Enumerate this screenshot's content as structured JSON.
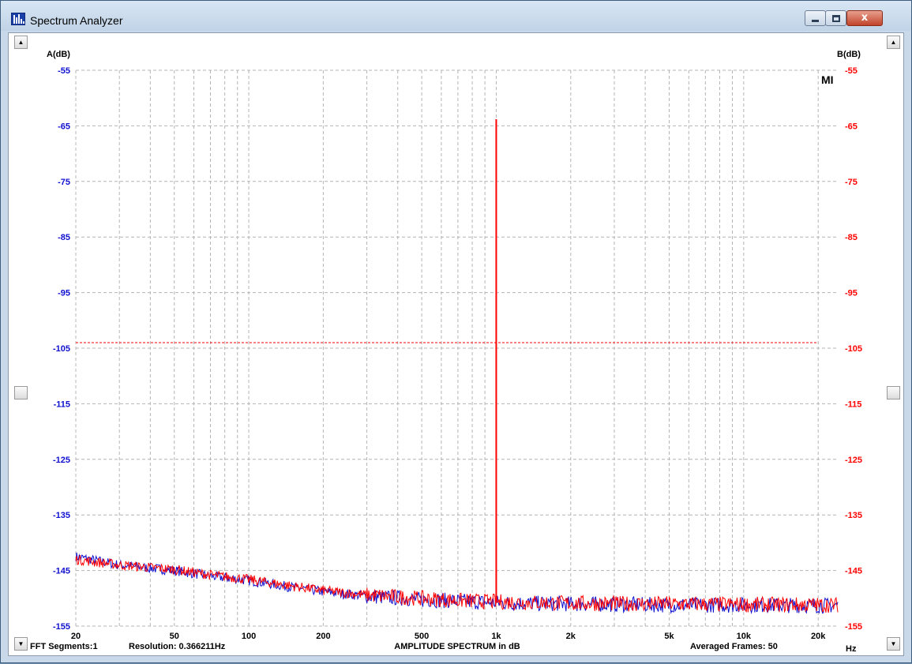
{
  "window": {
    "title": "Spectrum Analyzer",
    "close_glyph": "x",
    "icon": "spectrum-bars-icon"
  },
  "scroll_arrows": {
    "up": "▲",
    "down": "▼"
  },
  "footer": {
    "fft_segments": "FFT Segments:1",
    "resolution": "Resolution: 0.366211Hz",
    "center_label": "AMPLITUDE SPECTRUM in dB",
    "averaged_frames": "Averaged Frames: 50",
    "unit": "Hz"
  },
  "colors": {
    "channel_a": "#1010d0",
    "channel_b": "#ff0000",
    "grid": "#b4b4b4",
    "marker": "#e000e0"
  },
  "chart_data": {
    "type": "line",
    "x_scale": "log",
    "xlim": [
      20,
      24000
    ],
    "ylim": [
      -155,
      -55
    ],
    "grid": true,
    "left_axis_label": "A(dB)",
    "right_axis_label": "B(dB)",
    "corner_mark": "MI",
    "y_ticks": [
      -55,
      -65,
      -75,
      -85,
      -95,
      -105,
      -115,
      -125,
      -135,
      -145,
      -155
    ],
    "x_ticks": [
      {
        "value": 20,
        "label": "20"
      },
      {
        "value": 50,
        "label": "50"
      },
      {
        "value": 100,
        "label": "100"
      },
      {
        "value": 200,
        "label": "200"
      },
      {
        "value": 500,
        "label": "500"
      },
      {
        "value": 1000,
        "label": "1k"
      },
      {
        "value": 2000,
        "label": "2k"
      },
      {
        "value": 5000,
        "label": "5k"
      },
      {
        "value": 10000,
        "label": "10k"
      },
      {
        "value": 20000,
        "label": "20k"
      }
    ],
    "reference_line": {
      "y": -104.0,
      "xlim": [
        20,
        20000
      ]
    },
    "peak": {
      "x": 1000,
      "y": -63.8
    },
    "series": [
      {
        "channel": "A",
        "noise_floor": [
          [
            20,
            -142.5
          ],
          [
            30,
            -144.0
          ],
          [
            50,
            -145.0
          ],
          [
            70,
            -146.0
          ],
          [
            100,
            -146.8
          ],
          [
            150,
            -148.0
          ],
          [
            200,
            -148.8
          ],
          [
            300,
            -149.6
          ],
          [
            500,
            -150.2
          ],
          [
            700,
            -150.5
          ],
          [
            1000,
            -150.8
          ],
          [
            2000,
            -151.0
          ],
          [
            5000,
            -151.2
          ],
          [
            10000,
            -151.2
          ],
          [
            24000,
            -151.3
          ]
        ]
      },
      {
        "channel": "B",
        "noise_floor": [
          [
            20,
            -143.0
          ],
          [
            30,
            -144.0
          ],
          [
            50,
            -144.8
          ],
          [
            70,
            -145.8
          ],
          [
            100,
            -146.6
          ],
          [
            150,
            -147.8
          ],
          [
            200,
            -148.6
          ],
          [
            300,
            -149.4
          ],
          [
            500,
            -150.0
          ],
          [
            700,
            -150.4
          ],
          [
            1000,
            -150.6
          ],
          [
            2000,
            -150.9
          ],
          [
            5000,
            -151.0
          ],
          [
            10000,
            -151.1
          ],
          [
            24000,
            -151.2
          ]
        ]
      }
    ]
  }
}
